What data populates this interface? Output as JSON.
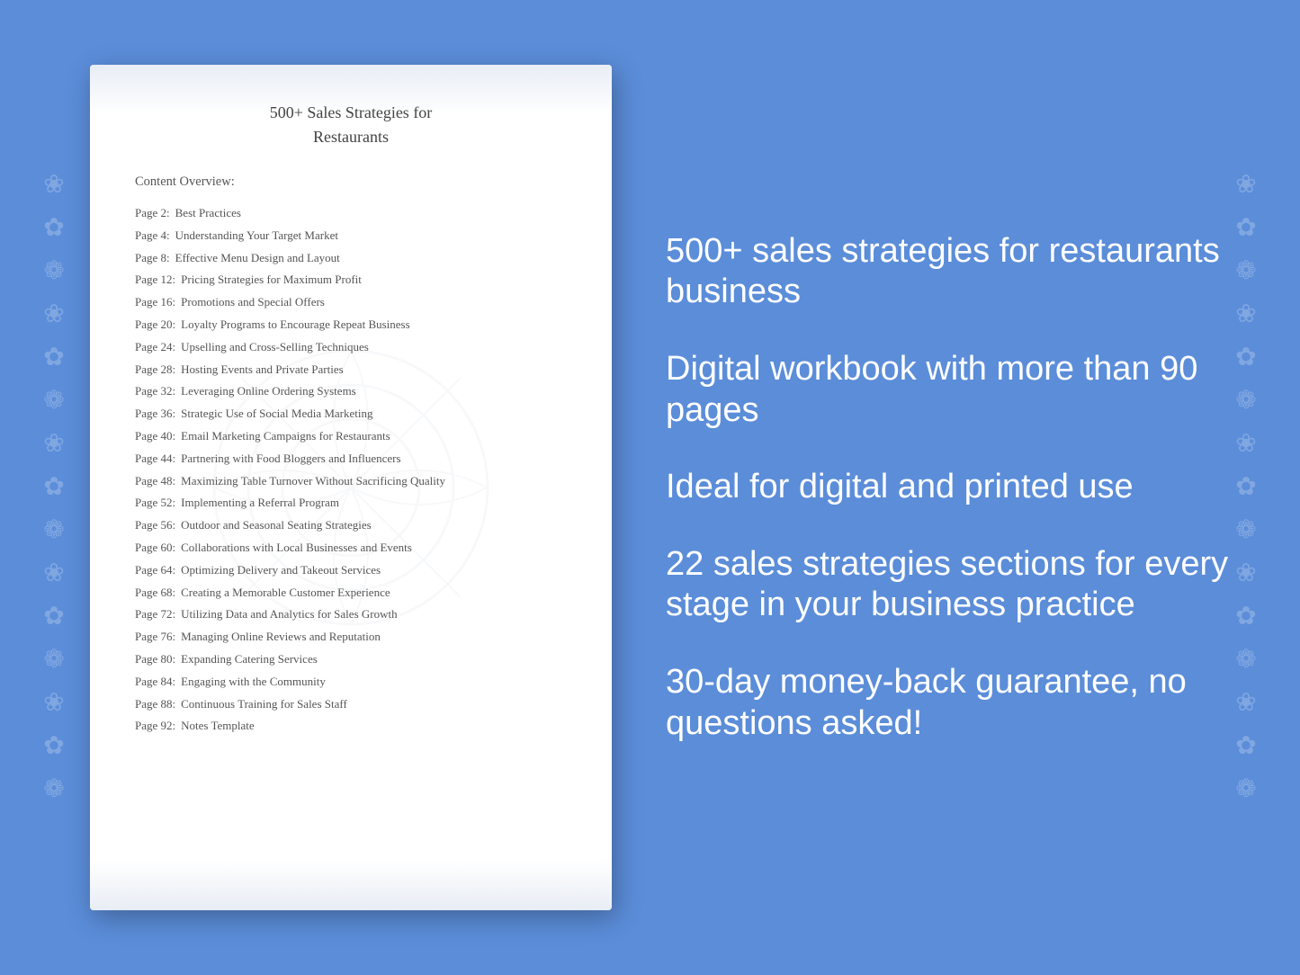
{
  "background": {
    "color": "#5b8dd9"
  },
  "document": {
    "title_line1": "500+ Sales Strategies for",
    "title_line2": "Restaurants",
    "toc_heading": "Content Overview:",
    "toc_items": [
      {
        "page": "Page  2:",
        "title": "Best Practices"
      },
      {
        "page": "Page  4:",
        "title": "Understanding Your Target Market"
      },
      {
        "page": "Page  8:",
        "title": "Effective Menu Design and Layout"
      },
      {
        "page": "Page 12:",
        "title": "Pricing Strategies for Maximum Profit"
      },
      {
        "page": "Page 16:",
        "title": "Promotions and Special Offers"
      },
      {
        "page": "Page 20:",
        "title": "Loyalty Programs to Encourage Repeat Business"
      },
      {
        "page": "Page 24:",
        "title": "Upselling and Cross-Selling Techniques"
      },
      {
        "page": "Page 28:",
        "title": "Hosting Events and Private Parties"
      },
      {
        "page": "Page 32:",
        "title": "Leveraging Online Ordering Systems"
      },
      {
        "page": "Page 36:",
        "title": "Strategic Use of Social Media Marketing"
      },
      {
        "page": "Page 40:",
        "title": "Email Marketing Campaigns for Restaurants"
      },
      {
        "page": "Page 44:",
        "title": "Partnering with Food Bloggers and Influencers"
      },
      {
        "page": "Page 48:",
        "title": "Maximizing Table Turnover Without Sacrificing Quality"
      },
      {
        "page": "Page 52:",
        "title": "Implementing a Referral Program"
      },
      {
        "page": "Page 56:",
        "title": "Outdoor and Seasonal Seating Strategies"
      },
      {
        "page": "Page 60:",
        "title": "Collaborations with Local Businesses and Events"
      },
      {
        "page": "Page 64:",
        "title": "Optimizing Delivery and Takeout Services"
      },
      {
        "page": "Page 68:",
        "title": "Creating a Memorable Customer Experience"
      },
      {
        "page": "Page 72:",
        "title": "Utilizing Data and Analytics for Sales Growth"
      },
      {
        "page": "Page 76:",
        "title": "Managing Online Reviews and Reputation"
      },
      {
        "page": "Page 80:",
        "title": "Expanding Catering Services"
      },
      {
        "page": "Page 84:",
        "title": "Engaging with the Community"
      },
      {
        "page": "Page 88:",
        "title": "Continuous Training for Sales Staff"
      },
      {
        "page": "Page 92:",
        "title": "Notes Template"
      }
    ]
  },
  "features": [
    "500+ sales strategies for restaurants business",
    "Digital workbook with more than 90 pages",
    "Ideal for digital and printed use",
    "22 sales strategies sections for every stage in your business practice",
    "30-day money-back guarantee, no questions asked!"
  ]
}
